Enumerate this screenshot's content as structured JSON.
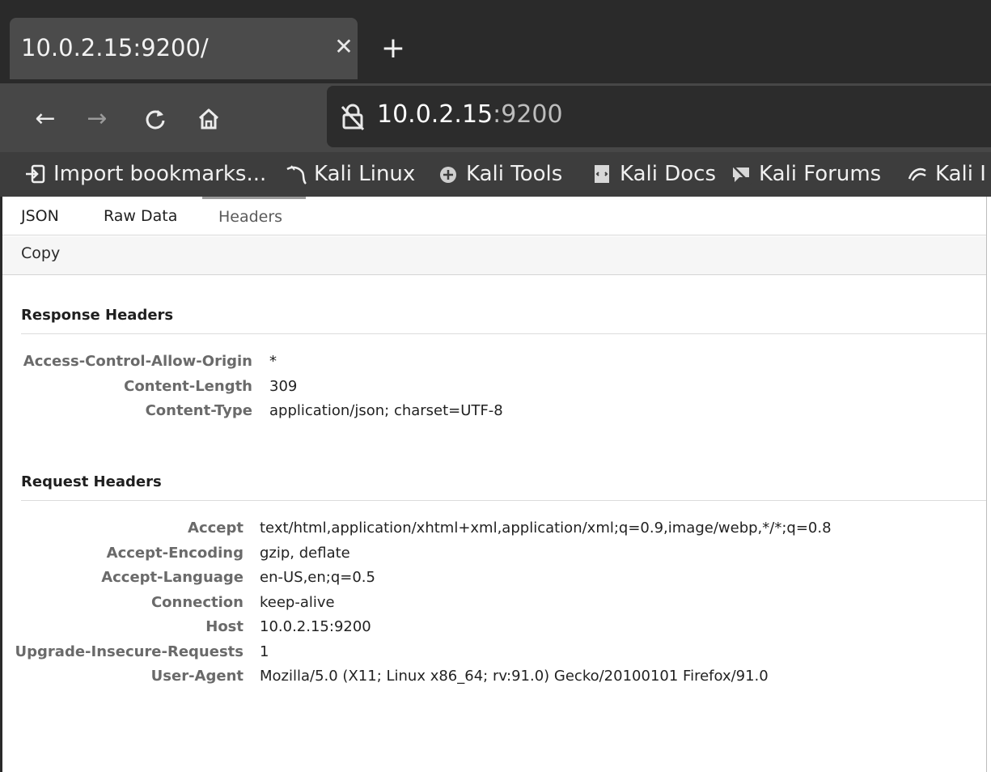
{
  "browser": {
    "tab_title": "10.0.2.15:9200/",
    "tab_close_icon": "close-icon",
    "new_tab_icon": "plus-icon",
    "nav": {
      "back_icon": "arrow-left-icon",
      "forward_icon": "arrow-right-icon",
      "reload_icon": "reload-icon",
      "home_icon": "home-icon"
    },
    "url": {
      "host": "10.0.2.15",
      "port": ":9200",
      "lock_icon": "insecure-lock-icon"
    },
    "bookmarks": [
      {
        "label": "Import bookmarks...",
        "icon": "import-icon"
      },
      {
        "label": "Kali Linux",
        "icon": "kali-dragon-icon"
      },
      {
        "label": "Kali Tools",
        "icon": "kali-tools-icon"
      },
      {
        "label": "Kali Docs",
        "icon": "kali-docs-icon"
      },
      {
        "label": "Kali Forums",
        "icon": "kali-forums-icon"
      },
      {
        "label": "Kali I",
        "icon": "kali-icon"
      }
    ]
  },
  "viewer": {
    "tabs": [
      {
        "label": "JSON",
        "active": false
      },
      {
        "label": "Raw Data",
        "active": false
      },
      {
        "label": "Headers",
        "active": true
      }
    ],
    "toolbar": {
      "copy_label": "Copy"
    },
    "response_headers": {
      "title": "Response Headers",
      "rows": [
        {
          "name": "Access-Control-Allow-Origin",
          "value": "*"
        },
        {
          "name": "Content-Length",
          "value": "309"
        },
        {
          "name": "Content-Type",
          "value": "application/json; charset=UTF-8"
        }
      ]
    },
    "request_headers": {
      "title": "Request Headers",
      "rows": [
        {
          "name": "Accept",
          "value": "text/html,application/xhtml+xml,application/xml;q=0.9,image/webp,*/*;q=0.8"
        },
        {
          "name": "Accept-Encoding",
          "value": "gzip, deflate"
        },
        {
          "name": "Accept-Language",
          "value": "en-US,en;q=0.5"
        },
        {
          "name": "Connection",
          "value": "keep-alive"
        },
        {
          "name": "Host",
          "value": "10.0.2.15:9200"
        },
        {
          "name": "Upgrade-Insecure-Requests",
          "value": "1"
        },
        {
          "name": "User-Agent",
          "value": "Mozilla/5.0 (X11; Linux x86_64; rv:91.0) Gecko/20100101 Firefox/91.0"
        }
      ]
    }
  }
}
